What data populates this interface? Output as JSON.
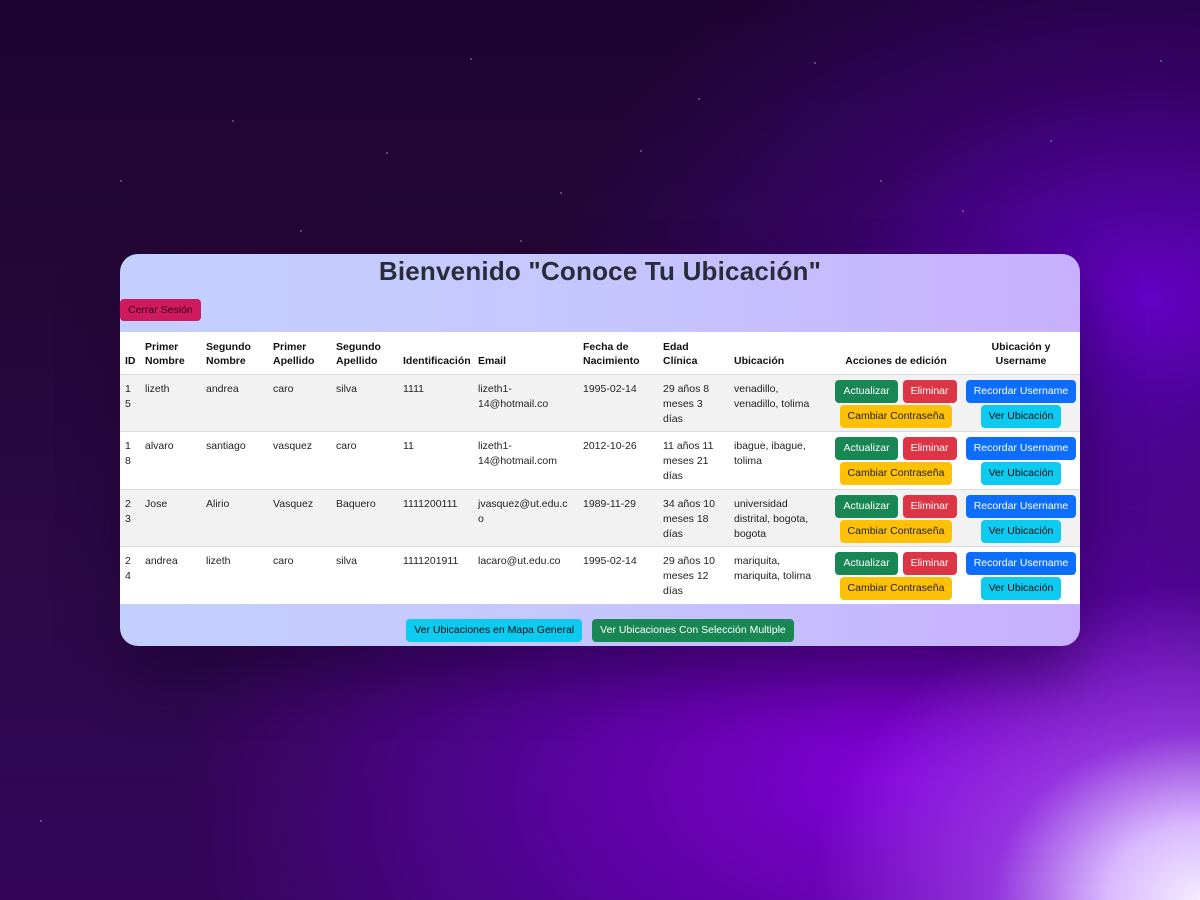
{
  "page": {
    "title": "Bienvenido \"Conoce Tu Ubicación\"",
    "logout_label": "Cerrar Sesión"
  },
  "table": {
    "headers": [
      "ID",
      "Primer Nombre",
      "Segundo Nombre",
      "Primer Apellido",
      "Segundo Apellido",
      "Identificación",
      "Email",
      "Fecha de Nacimiento",
      "Edad Clínica",
      "Ubicación",
      "Acciones de edición",
      "Ubicación y Username"
    ],
    "rows": [
      {
        "id": "15",
        "primer_nombre": "lizeth",
        "segundo_nombre": "andrea",
        "primer_apellido": "caro",
        "segundo_apellido": "silva",
        "identificacion": "1111",
        "email": "lizeth1-14@hotmail.co",
        "fecha": "1995-02-14",
        "edad": "29 años 8 meses 3 días",
        "ubicacion": "venadillo, venadillo, tolima"
      },
      {
        "id": "18",
        "primer_nombre": "alvaro",
        "segundo_nombre": "santiago",
        "primer_apellido": "vasquez",
        "segundo_apellido": "caro",
        "identificacion": "11",
        "email": "lizeth1-14@hotmail.com",
        "fecha": "2012-10-26",
        "edad": "11 años 11 meses 21 días",
        "ubicacion": "ibague, ibague, tolima"
      },
      {
        "id": "23",
        "primer_nombre": "Jose",
        "segundo_nombre": "Alirio",
        "primer_apellido": "Vasquez",
        "segundo_apellido": "Baquero",
        "identificacion": "1111200111",
        "email": "jvasquez@ut.edu.co",
        "fecha": "1989-11-29",
        "edad": "34 años 10 meses 18 días",
        "ubicacion": "universidad distrital, bogota, bogota"
      },
      {
        "id": "24",
        "primer_nombre": "andrea",
        "segundo_nombre": "lizeth",
        "primer_apellido": "caro",
        "segundo_apellido": "silva",
        "identificacion": "1111201911",
        "email": "lacaro@ut.edu.co",
        "fecha": "1995-02-14",
        "edad": "29 años 10 meses 12 días",
        "ubicacion": "mariquita, mariquita, tolima"
      }
    ]
  },
  "row_actions": {
    "update_label": "Actualizar",
    "delete_label": "Eliminar",
    "change_password_label": "Cambiar Contraseña",
    "remember_username_label": "Recordar Username",
    "view_location_label": "Ver Ubicación"
  },
  "footer": {
    "map_general_label": "Ver Ubicaciones en Mapa General",
    "multi_select_label": "Ver Ubicaciones Con Selección Multiple"
  },
  "colors": {
    "success": "#198754",
    "danger": "#dc3545",
    "warning": "#ffc107",
    "primary": "#0d6efd",
    "info": "#0dcaf0",
    "logout": "#d11a5e"
  }
}
